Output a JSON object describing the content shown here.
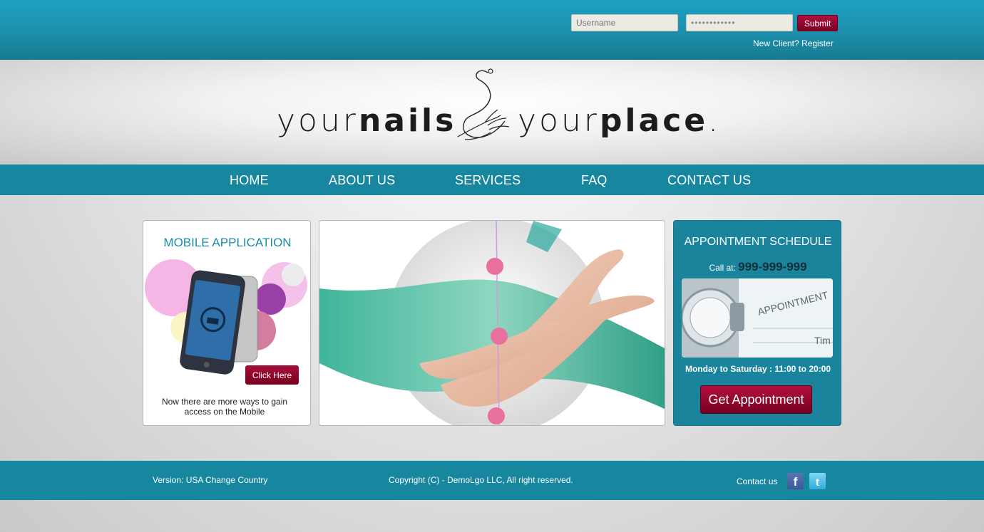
{
  "login": {
    "username_placeholder": "Username",
    "password_value": "••••••••••••",
    "submit_label": "Submit",
    "register_link": "New Client? Register"
  },
  "logo": {
    "word_left_thin": "your",
    "word_left_bold": "nails",
    "word_right_thin": "your",
    "word_right_bold": "place",
    "trademark": "."
  },
  "nav": {
    "items": [
      "HOME",
      "ABOUT US",
      "SERVICES",
      "FAQ",
      "CONTACT US"
    ]
  },
  "mobile": {
    "title": "MOBILE APPLICATION",
    "button_label": "Click Here",
    "text": "Now there are more ways to gain access on the Mobile"
  },
  "appointment": {
    "title": "APPOINTMENT SCHEDULE",
    "call_label": "Call at:",
    "phone": "999-999-999",
    "image_text": "APPOINTMENT",
    "image_text2": "Tim",
    "hours": "Monday to Saturday : 11:00 to 20:00",
    "button_label": "Get Appointment"
  },
  "footer": {
    "version": "Version: USA Change Country",
    "copyright": "Copyright (C) - DemoLgo LLC, All right reserved.",
    "contact": "Contact us",
    "facebook_glyph": "f",
    "twitter_glyph": "t"
  },
  "icons": {
    "facebook": "facebook-icon",
    "twitter": "twitter-icon",
    "logo_hand": "hand-swirl-icon"
  },
  "colors": {
    "brand_teal": "#17869f",
    "accent_crimson": "#8c0a2d"
  }
}
